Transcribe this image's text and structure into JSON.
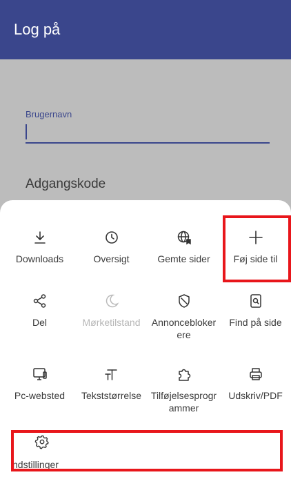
{
  "appbar": {
    "title": "Log på"
  },
  "login": {
    "username_label": "Brugernavn",
    "password_placeholder": "Adgangskode"
  },
  "menu": {
    "items": [
      {
        "label": "Downloads",
        "icon": "download-icon"
      },
      {
        "label": "Oversigt",
        "icon": "clock-icon"
      },
      {
        "label": "Gemte sider",
        "icon": "saved-pages-icon"
      },
      {
        "label": "Føj side til",
        "icon": "plus-icon"
      },
      {
        "label": "Del",
        "icon": "share-icon"
      },
      {
        "label": "Mørketilstand",
        "icon": "moon-icon",
        "disabled": true
      },
      {
        "label": "Annonceblokerere",
        "icon": "shield-icon"
      },
      {
        "label": "Find på side",
        "icon": "find-in-page-icon"
      },
      {
        "label": "Pc-websted",
        "icon": "desktop-icon"
      },
      {
        "label": "Tekststørrelse",
        "icon": "text-size-icon"
      },
      {
        "label": "Tilføjelsesprogrammer",
        "icon": "addons-icon"
      },
      {
        "label": "Udskriv/PDF",
        "icon": "print-icon"
      }
    ],
    "settings_label": "ndstillinger"
  },
  "colors": {
    "appbar": "#3a468c",
    "accent": "#3a468c",
    "highlight": "#e8161b",
    "dim_overlay": "#bcbcbc"
  }
}
